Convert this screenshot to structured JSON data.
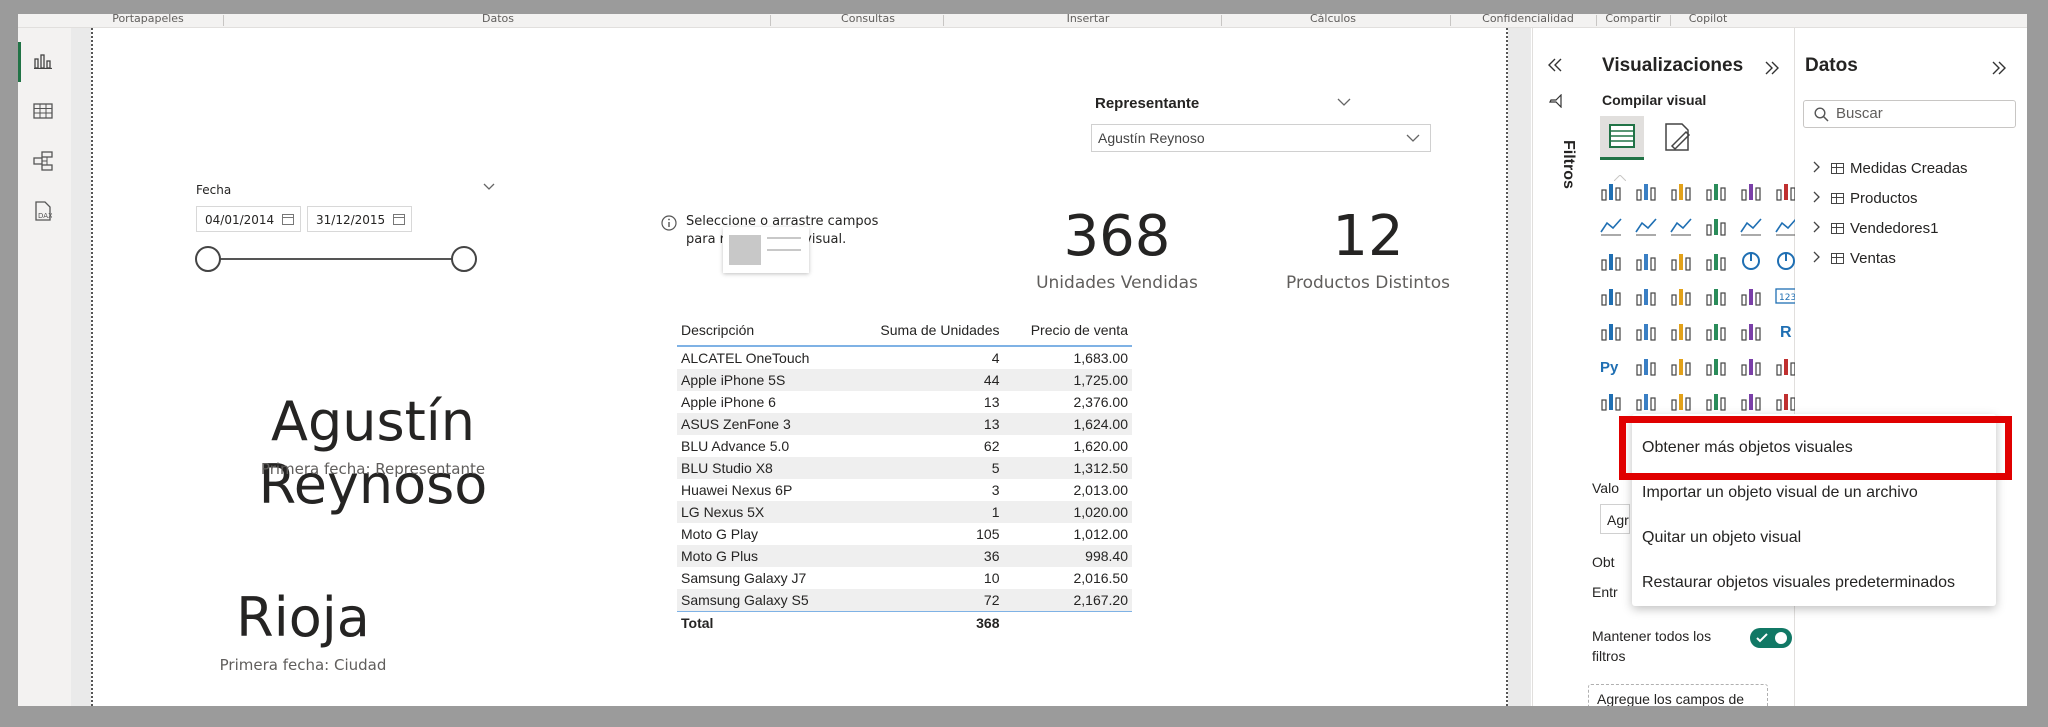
{
  "ribbon": {
    "groups": [
      "Portapapeles",
      "Datos",
      "Consultas",
      "Insertar",
      "Cálculos",
      "Confidencialidad",
      "Compartir",
      "Copilot"
    ]
  },
  "rail": {
    "items": [
      "report-view-icon",
      "table-view-icon",
      "model-view-icon",
      "dax-query-view-icon"
    ]
  },
  "slicer_fecha": {
    "title": "Fecha",
    "start": "04/01/2014",
    "end": "31/12/2015"
  },
  "placeholder_visual": {
    "text_line1": "Seleccione o arrastre campos",
    "text_line2_a": "para r",
    "text_line2_b": "eto visual."
  },
  "slicer_representante": {
    "title": "Representante",
    "value": "Agustín Reynoso"
  },
  "cards": {
    "units_value": "368",
    "units_label": "Unidades Vendidas",
    "products_value": "12",
    "products_label": "Productos Distintos"
  },
  "name_card": {
    "value": "Agustín Reynoso",
    "caption": "Primera fecha: Representante"
  },
  "city_card": {
    "value": "Rioja",
    "caption": "Primera fecha: Ciudad"
  },
  "table": {
    "headers": [
      "Descripción",
      "Suma de Unidades",
      "Precio de venta"
    ],
    "rows": [
      [
        "ALCATEL OneTouch",
        "4",
        "1,683.00"
      ],
      [
        "Apple iPhone 5S",
        "44",
        "1,725.00"
      ],
      [
        "Apple iPhone 6",
        "13",
        "2,376.00"
      ],
      [
        "ASUS ZenFone 3",
        "13",
        "1,624.00"
      ],
      [
        "BLU Advance 5.0",
        "62",
        "1,620.00"
      ],
      [
        "BLU Studio X8",
        "5",
        "1,312.50"
      ],
      [
        "Huawei Nexus 6P",
        "3",
        "2,013.00"
      ],
      [
        "LG Nexus 5X",
        "1",
        "1,020.00"
      ],
      [
        "Moto G Play",
        "105",
        "1,012.00"
      ],
      [
        "Moto G Plus",
        "36",
        "998.40"
      ],
      [
        "Samsung Galaxy J7",
        "10",
        "2,016.50"
      ],
      [
        "Samsung Galaxy S5",
        "72",
        "2,167.20"
      ]
    ],
    "total_label": "Total",
    "total_units": "368"
  },
  "filters_panel": {
    "label": "Filtros"
  },
  "viz_panel": {
    "title": "Visualizaciones",
    "build_label": "Compilar visual",
    "partial_labels": {
      "values": "Valo",
      "add": "Agr",
      "obtain": "Obt",
      "entr": "Entr"
    },
    "keep_filters_line1": "Mantener todos los",
    "keep_filters_line2": "filtros",
    "add_fields_button": "Agregue los campos de ob..."
  },
  "datos_panel": {
    "title": "Datos",
    "search_placeholder": "Buscar",
    "tables": [
      "Medidas Creadas",
      "Productos",
      "Vendedores1",
      "Ventas"
    ]
  },
  "context_menu": {
    "items": [
      "Obtener más objetos visuales",
      "Importar un objeto visual de un archivo",
      "Quitar un objeto visual",
      "Restaurar objetos visuales predeterminados"
    ]
  },
  "colors": {
    "accent_green": "#217346",
    "highlight_red": "#e00000",
    "toggle_green": "#117865",
    "table_rule": "#7fb2e5"
  }
}
